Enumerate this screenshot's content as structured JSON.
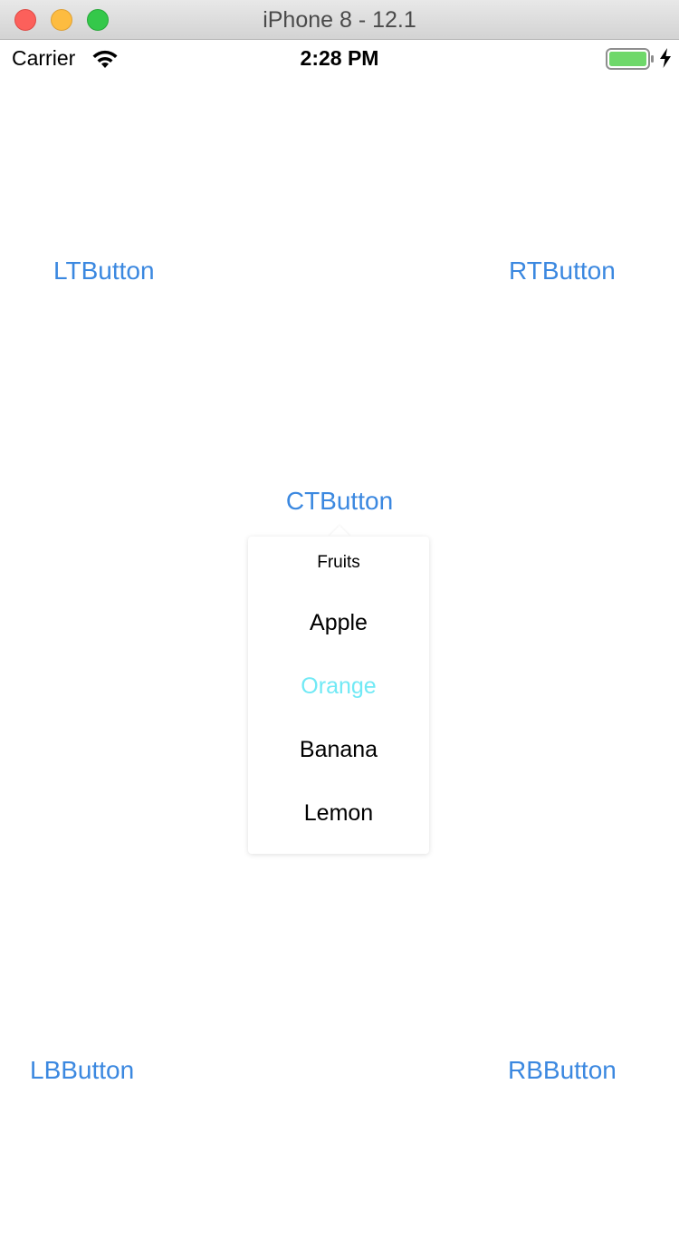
{
  "window": {
    "title": "iPhone 8 - 12.1"
  },
  "status_bar": {
    "carrier": "Carrier",
    "time": "2:28 PM",
    "icons": [
      "wifi-icon",
      "battery-icon",
      "charging-bolt-icon"
    ],
    "battery_color": "#6fd86a"
  },
  "buttons": {
    "left_top": "LTButton",
    "right_top": "RTButton",
    "center_top": "CTButton",
    "left_bottom": "LBButton",
    "right_bottom": "RBButton",
    "color": "#3b88e0"
  },
  "popover": {
    "title": "Fruits",
    "items": [
      {
        "label": "Apple",
        "selected": false
      },
      {
        "label": "Orange",
        "selected": true
      },
      {
        "label": "Banana",
        "selected": false
      },
      {
        "label": "Lemon",
        "selected": false
      }
    ],
    "selected_color": "#71e9f5"
  }
}
